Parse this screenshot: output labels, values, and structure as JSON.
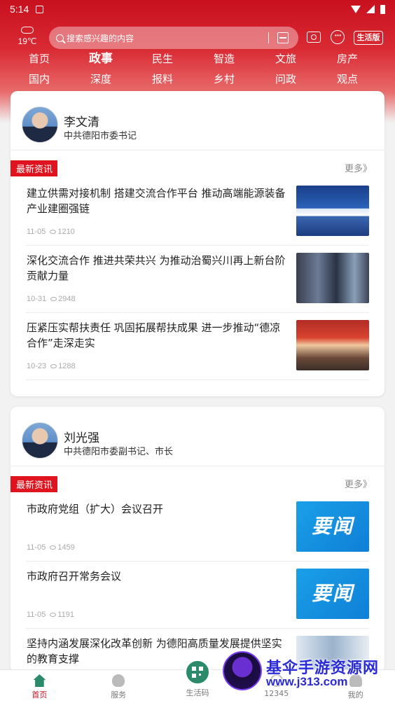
{
  "status_bar": {
    "time": "5:14"
  },
  "weather": {
    "temperature": "19℃"
  },
  "search": {
    "placeholder": "搜索感兴趣的内容"
  },
  "mode_button": "生活版",
  "channels": [
    [
      {
        "label": "首页"
      },
      {
        "label": "政事",
        "active": true
      },
      {
        "label": "民生"
      },
      {
        "label": "智造"
      },
      {
        "label": "文旅"
      },
      {
        "label": "房产"
      }
    ],
    [
      {
        "label": "国内"
      },
      {
        "label": "深度"
      },
      {
        "label": "报料"
      },
      {
        "label": "乡村"
      },
      {
        "label": "问政"
      },
      {
        "label": "观点"
      }
    ]
  ],
  "leaders": [
    {
      "name": "李文清",
      "title": "中共德阳市委书记",
      "badge": "最新资讯",
      "more": "更多》",
      "news": [
        {
          "title": "建立供需对接机制 搭建交流合作平台 推动高端能源装备产业建圈强链",
          "date": "11-05",
          "views": "1210",
          "thumb": "conference-photo"
        },
        {
          "title": "深化交流合作 推进共荣共兴 为推动治蜀兴川再上新台阶贡献力量",
          "date": "10-31",
          "views": "2948",
          "thumb": "visit-photo"
        },
        {
          "title": "压紧压实帮扶责任 巩固拓展帮扶成果 进一步推动“德凉合作”走深走实",
          "date": "10-23",
          "views": "1288",
          "thumb": "meeting-photo"
        }
      ]
    },
    {
      "name": "刘光强",
      "title": "中共德阳市委副书记、市长",
      "badge": "最新资讯",
      "more": "更多》",
      "news": [
        {
          "title": "市政府党组（扩大）会议召开",
          "date": "11-05",
          "views": "1459",
          "thumb": "yaowen",
          "thumb_text": "要闻"
        },
        {
          "title": "市政府召开常务会议",
          "date": "11-05",
          "views": "1191",
          "thumb": "yaowen",
          "thumb_text": "要闻"
        },
        {
          "title": "坚持内涵发展深化改革创新 为德阳高质量发展提供坚实的教育支撑",
          "date": "",
          "views": "",
          "thumb": "school-photo"
        }
      ]
    }
  ],
  "tabbar": [
    {
      "label": "首页",
      "icon": "home-icon",
      "active": true
    },
    {
      "label": "服务",
      "icon": "service-icon"
    },
    {
      "label": "生活码",
      "icon": "qr-code-icon"
    },
    {
      "label": "12345",
      "icon": "phone-icon"
    },
    {
      "label": "我的",
      "icon": "profile-icon"
    }
  ],
  "watermark": {
    "line1": "基伞手游资源网",
    "line2": "www.j313.com"
  },
  "colors": {
    "brand_red": "#c8101e",
    "badge_red": "#e0141e",
    "tab_green": "#2b8a6a"
  }
}
